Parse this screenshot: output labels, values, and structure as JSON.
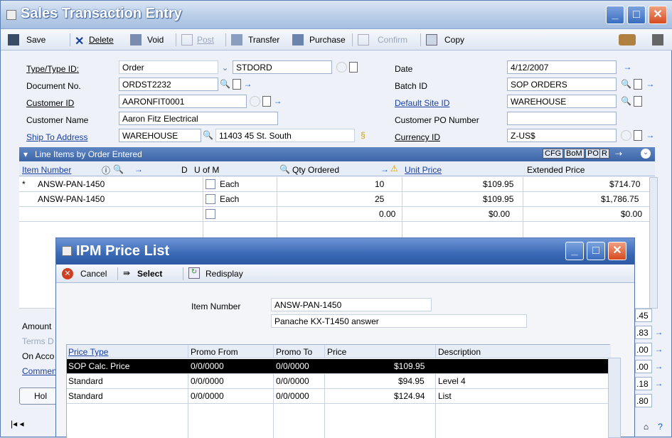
{
  "window": {
    "title": "Sales Transaction Entry"
  },
  "toolbar": {
    "save": "Save",
    "delete": "Delete",
    "void": "Void",
    "post": "Post",
    "transfer": "Transfer",
    "purchase": "Purchase",
    "confirm": "Confirm",
    "copy": "Copy"
  },
  "header": {
    "type_label": "Type/Type ID:",
    "type_value": "Order",
    "type_id": "STDORD",
    "docno_label": "Document No.",
    "docno_value": "ORDST2232",
    "customer_id_label": "Customer ID",
    "customer_id_value": "AARONFIT0001",
    "customer_name_label": "Customer Name",
    "customer_name_value": "Aaron Fitz Electrical",
    "shipto_label": "Ship To Address",
    "shipto_value": "WAREHOUSE",
    "shipto_addr": "11403 45 St. South",
    "date_label": "Date",
    "date_value": "4/12/2007",
    "batch_label": "Batch ID",
    "batch_value": "SOP ORDERS",
    "site_label": "Default Site ID",
    "site_value": "WAREHOUSE",
    "po_label": "Customer PO Number",
    "po_value": "",
    "currency_label": "Currency ID",
    "currency_value": "Z-US$"
  },
  "grid": {
    "title": "Line Items by Order Entered",
    "buttons": [
      "CFG",
      "BoM",
      "PO",
      "R"
    ],
    "columns": {
      "item": "Item Number",
      "d": "D",
      "uofm": "U of M",
      "qty": "Qty Ordered",
      "price": "Unit Price",
      "ext": "Extended Price"
    },
    "rows": [
      {
        "marker": "*",
        "item": "ANSW-PAN-1450",
        "uofm": "Each",
        "qty": "10",
        "price": "$109.95",
        "ext": "$714.70"
      },
      {
        "marker": "",
        "item": "ANSW-PAN-1450",
        "uofm": "Each",
        "qty": "25",
        "price": "$109.95",
        "ext": "$1,786.75"
      },
      {
        "marker": "",
        "item": "",
        "uofm": "",
        "qty": "0.00",
        "price": "$0.00",
        "ext": "$0.00"
      }
    ]
  },
  "footer": {
    "amount": "Amount",
    "terms": "Terms D",
    "onacct": "On Acco",
    "comment": "Commen",
    "hold": "Hol",
    "totals": [
      ".45",
      ".83",
      ".00",
      ".00",
      ".18",
      ".80"
    ]
  },
  "popup": {
    "title": "IPM Price List",
    "cancel": "Cancel",
    "select": "Select",
    "redisplay": "Redisplay",
    "item_label": "Item Number",
    "item_value": "ANSW-PAN-1450",
    "item_desc": "Panache KX-T1450 answer",
    "columns": {
      "type": "Price Type",
      "from": "Promo From",
      "to": "Promo To",
      "price": "Price",
      "desc": "Description"
    },
    "rows": [
      {
        "type": "SOP Calc. Price",
        "from": "0/0/0000",
        "to": "0/0/0000",
        "price": "$109.95",
        "desc": ""
      },
      {
        "type": "Standard",
        "from": "0/0/0000",
        "to": "0/0/0000",
        "price": "$94.95",
        "desc": "Level 4"
      },
      {
        "type": "Standard",
        "from": "0/0/0000",
        "to": "0/0/0000",
        "price": "$124.94",
        "desc": "List"
      }
    ]
  }
}
